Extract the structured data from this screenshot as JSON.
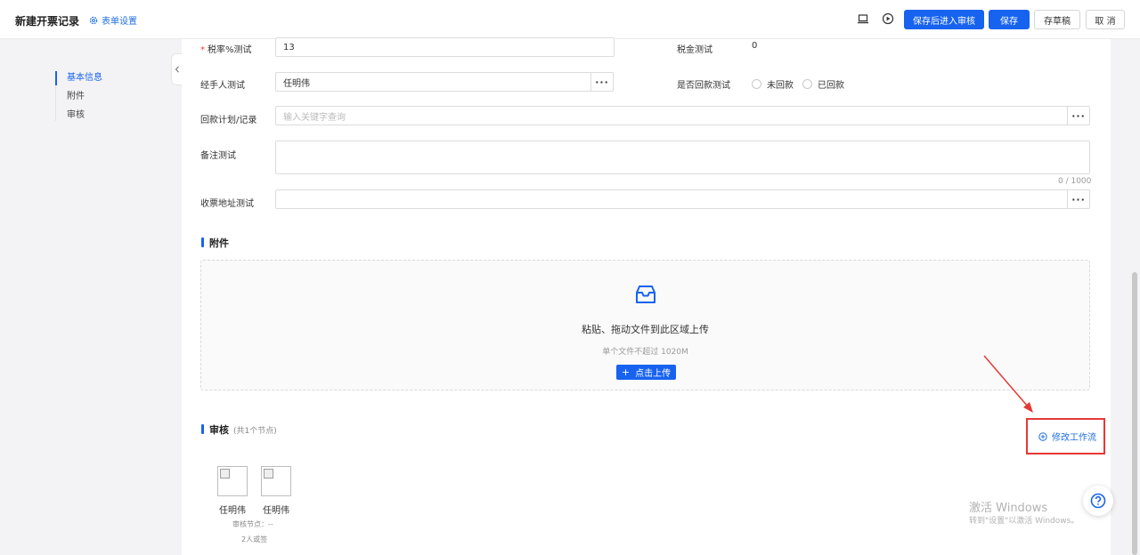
{
  "header": {
    "title": "新建开票记录",
    "form_settings": "表单设置",
    "buttons": {
      "save_submit": "保存后进入审核",
      "save": "保存",
      "draft": "存草稿",
      "cancel": "取 消"
    }
  },
  "anchor_nav": {
    "items": [
      {
        "label": "基本信息",
        "active": true
      },
      {
        "label": "附件",
        "active": false
      },
      {
        "label": "审核",
        "active": false
      }
    ]
  },
  "form": {
    "tax_rate": {
      "label": "税率%测试",
      "value": "13",
      "required": true
    },
    "tax_amount": {
      "label": "税金测试",
      "value": "0"
    },
    "handler": {
      "label": "经手人测试",
      "value": "任明伟"
    },
    "payment_returned": {
      "label": "是否回款测试",
      "options": [
        "未回款",
        "已回款"
      ]
    },
    "payment_plan": {
      "label": "回款计划/记录",
      "placeholder": "输入关键字查询"
    },
    "remark": {
      "label": "备注测试",
      "counter": "0 / 1000"
    },
    "invoice_address": {
      "label": "收票地址测试"
    }
  },
  "attachments": {
    "title": "附件",
    "drop_text": "粘贴、拖动文件到此区域上传",
    "limit_text": "单个文件不超过 1020M",
    "upload_button": "点击上传"
  },
  "review": {
    "title": "审核",
    "subtitle": "(共1个节点)",
    "modify_workflow": "修改工作流",
    "approvers": [
      "任明伟",
      "任明伟"
    ],
    "node_text": "审核节点：--",
    "sign_mode": "2人或签"
  },
  "watermark": {
    "line1": "激活 Windows",
    "line2": "转到\"设置\"以激活 Windows。"
  },
  "colors": {
    "primary": "#1763f0",
    "required": "#f0443a",
    "annotation": "#e53935"
  }
}
